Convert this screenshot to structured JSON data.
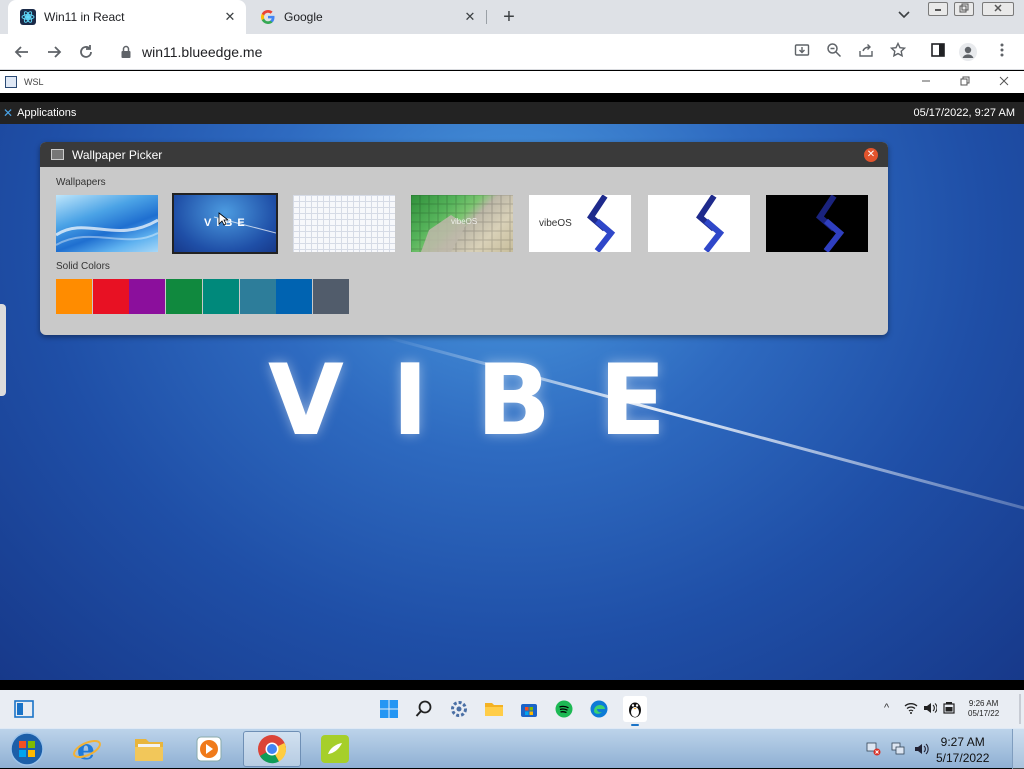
{
  "browser": {
    "tabs": [
      {
        "title": "Win11 in React",
        "active": true
      },
      {
        "title": "Google",
        "active": false
      }
    ],
    "url": "win11.blueedge.me",
    "new_tab_symbol": "+",
    "tab_close_symbol": "✕"
  },
  "wsl_window": {
    "title": "WSL"
  },
  "xfce_panel": {
    "applications_label": "Applications",
    "datetime": "05/17/2022, 9:27 AM"
  },
  "desktop": {
    "wallpaper_text": "VIBE"
  },
  "wallpaper_picker": {
    "title": "Wallpaper Picker",
    "wallpapers_label": "Wallpapers",
    "solid_colors_label": "Solid Colors",
    "selected_wallpaper_index": 1,
    "wallpapers": [
      {
        "name": "blue-waves"
      },
      {
        "name": "vibe-blue",
        "text": "VIBE"
      },
      {
        "name": "white-grid"
      },
      {
        "name": "green-tiles",
        "text": "vibeOS"
      },
      {
        "name": "vibeos-logo-white-with-text",
        "text": "vibeOS"
      },
      {
        "name": "vibeos-logo-white"
      },
      {
        "name": "vibeos-logo-black"
      }
    ],
    "solid_colors": [
      "#ff8c00",
      "#e81123",
      "#8b0f9c",
      "#10893e",
      "#00897b",
      "#2d7d9a",
      "#0063b1",
      "#515c6b"
    ]
  },
  "win11_taskbar": {
    "time": "9:26 AM",
    "date": "05/17/22",
    "tray_arrow": "^",
    "apps": [
      "start-icon",
      "search-icon",
      "settings-icon",
      "file-explorer-icon",
      "store-icon",
      "spotify-icon",
      "edge-icon",
      "wsl-penguin-icon"
    ]
  },
  "win7_taskbar": {
    "time": "9:27 AM",
    "date": "5/17/2022",
    "items": [
      "start-orb-icon",
      "internet-explorer-icon",
      "windows-explorer-icon",
      "media-player-icon",
      "chrome-icon",
      "app-icon"
    ]
  }
}
